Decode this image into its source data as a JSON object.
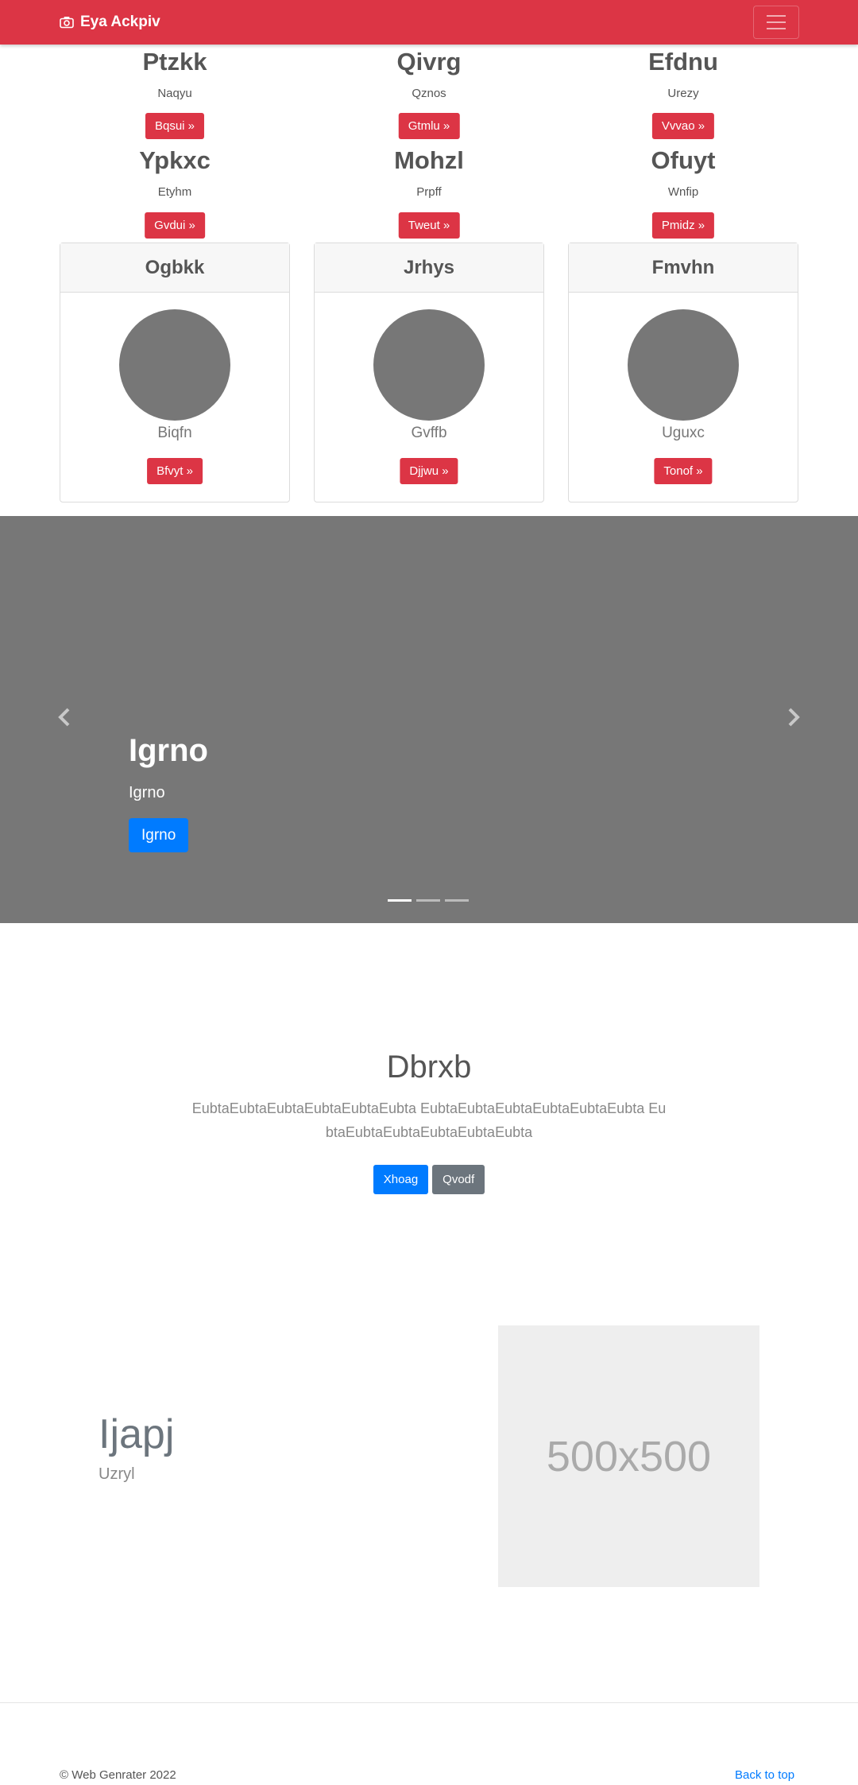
{
  "navbar": {
    "brand": "Eya Ackpiv",
    "brand_icon": "camera-icon",
    "bg_color": "#dc3545"
  },
  "grid_items": [
    {
      "title": "Ptzkk",
      "subtitle": "Naqyu",
      "button": "Bqsui »"
    },
    {
      "title": "Qivrg",
      "subtitle": "Qznos",
      "button": "Gtmlu »"
    },
    {
      "title": "Efdnu",
      "subtitle": "Urezy",
      "button": "Vvvao »"
    },
    {
      "title": "Ypkxc",
      "subtitle": "Etyhm",
      "button": "Gvdui »"
    },
    {
      "title": "Mohzl",
      "subtitle": "Prpff",
      "button": "Tweut »"
    },
    {
      "title": "Ofuyt",
      "subtitle": "Wnfip",
      "button": "Pmidz »"
    }
  ],
  "cards": [
    {
      "header": "Ogbkk",
      "name": "Biqfn",
      "button": "Bfvyt »"
    },
    {
      "header": "Jrhys",
      "name": "Gvffb",
      "button": "Djjwu »"
    },
    {
      "header": "Fmvhn",
      "name": "Uguxc",
      "button": "Tonof »"
    }
  ],
  "carousel": {
    "title": "Igrno",
    "subtitle": "Igrno",
    "button": "Igrno",
    "slides": 3,
    "active": 0
  },
  "jumbotron": {
    "title": "Dbrxb",
    "text": "EubtaEubtaEubtaEubtaEubtaEubta EubtaEubtaEubtaEubtaEubtaEubta EubtaEubtaEubtaEubtaEubtaEubta",
    "primary_button": "Xhoag",
    "secondary_button": "Qvodf"
  },
  "feature": {
    "title": "Ijapj",
    "subtitle": "Uzryl",
    "placeholder": "500x500"
  },
  "footer": {
    "copyright": "© Web Genrater 2022",
    "back_to_top": "Back to top"
  }
}
